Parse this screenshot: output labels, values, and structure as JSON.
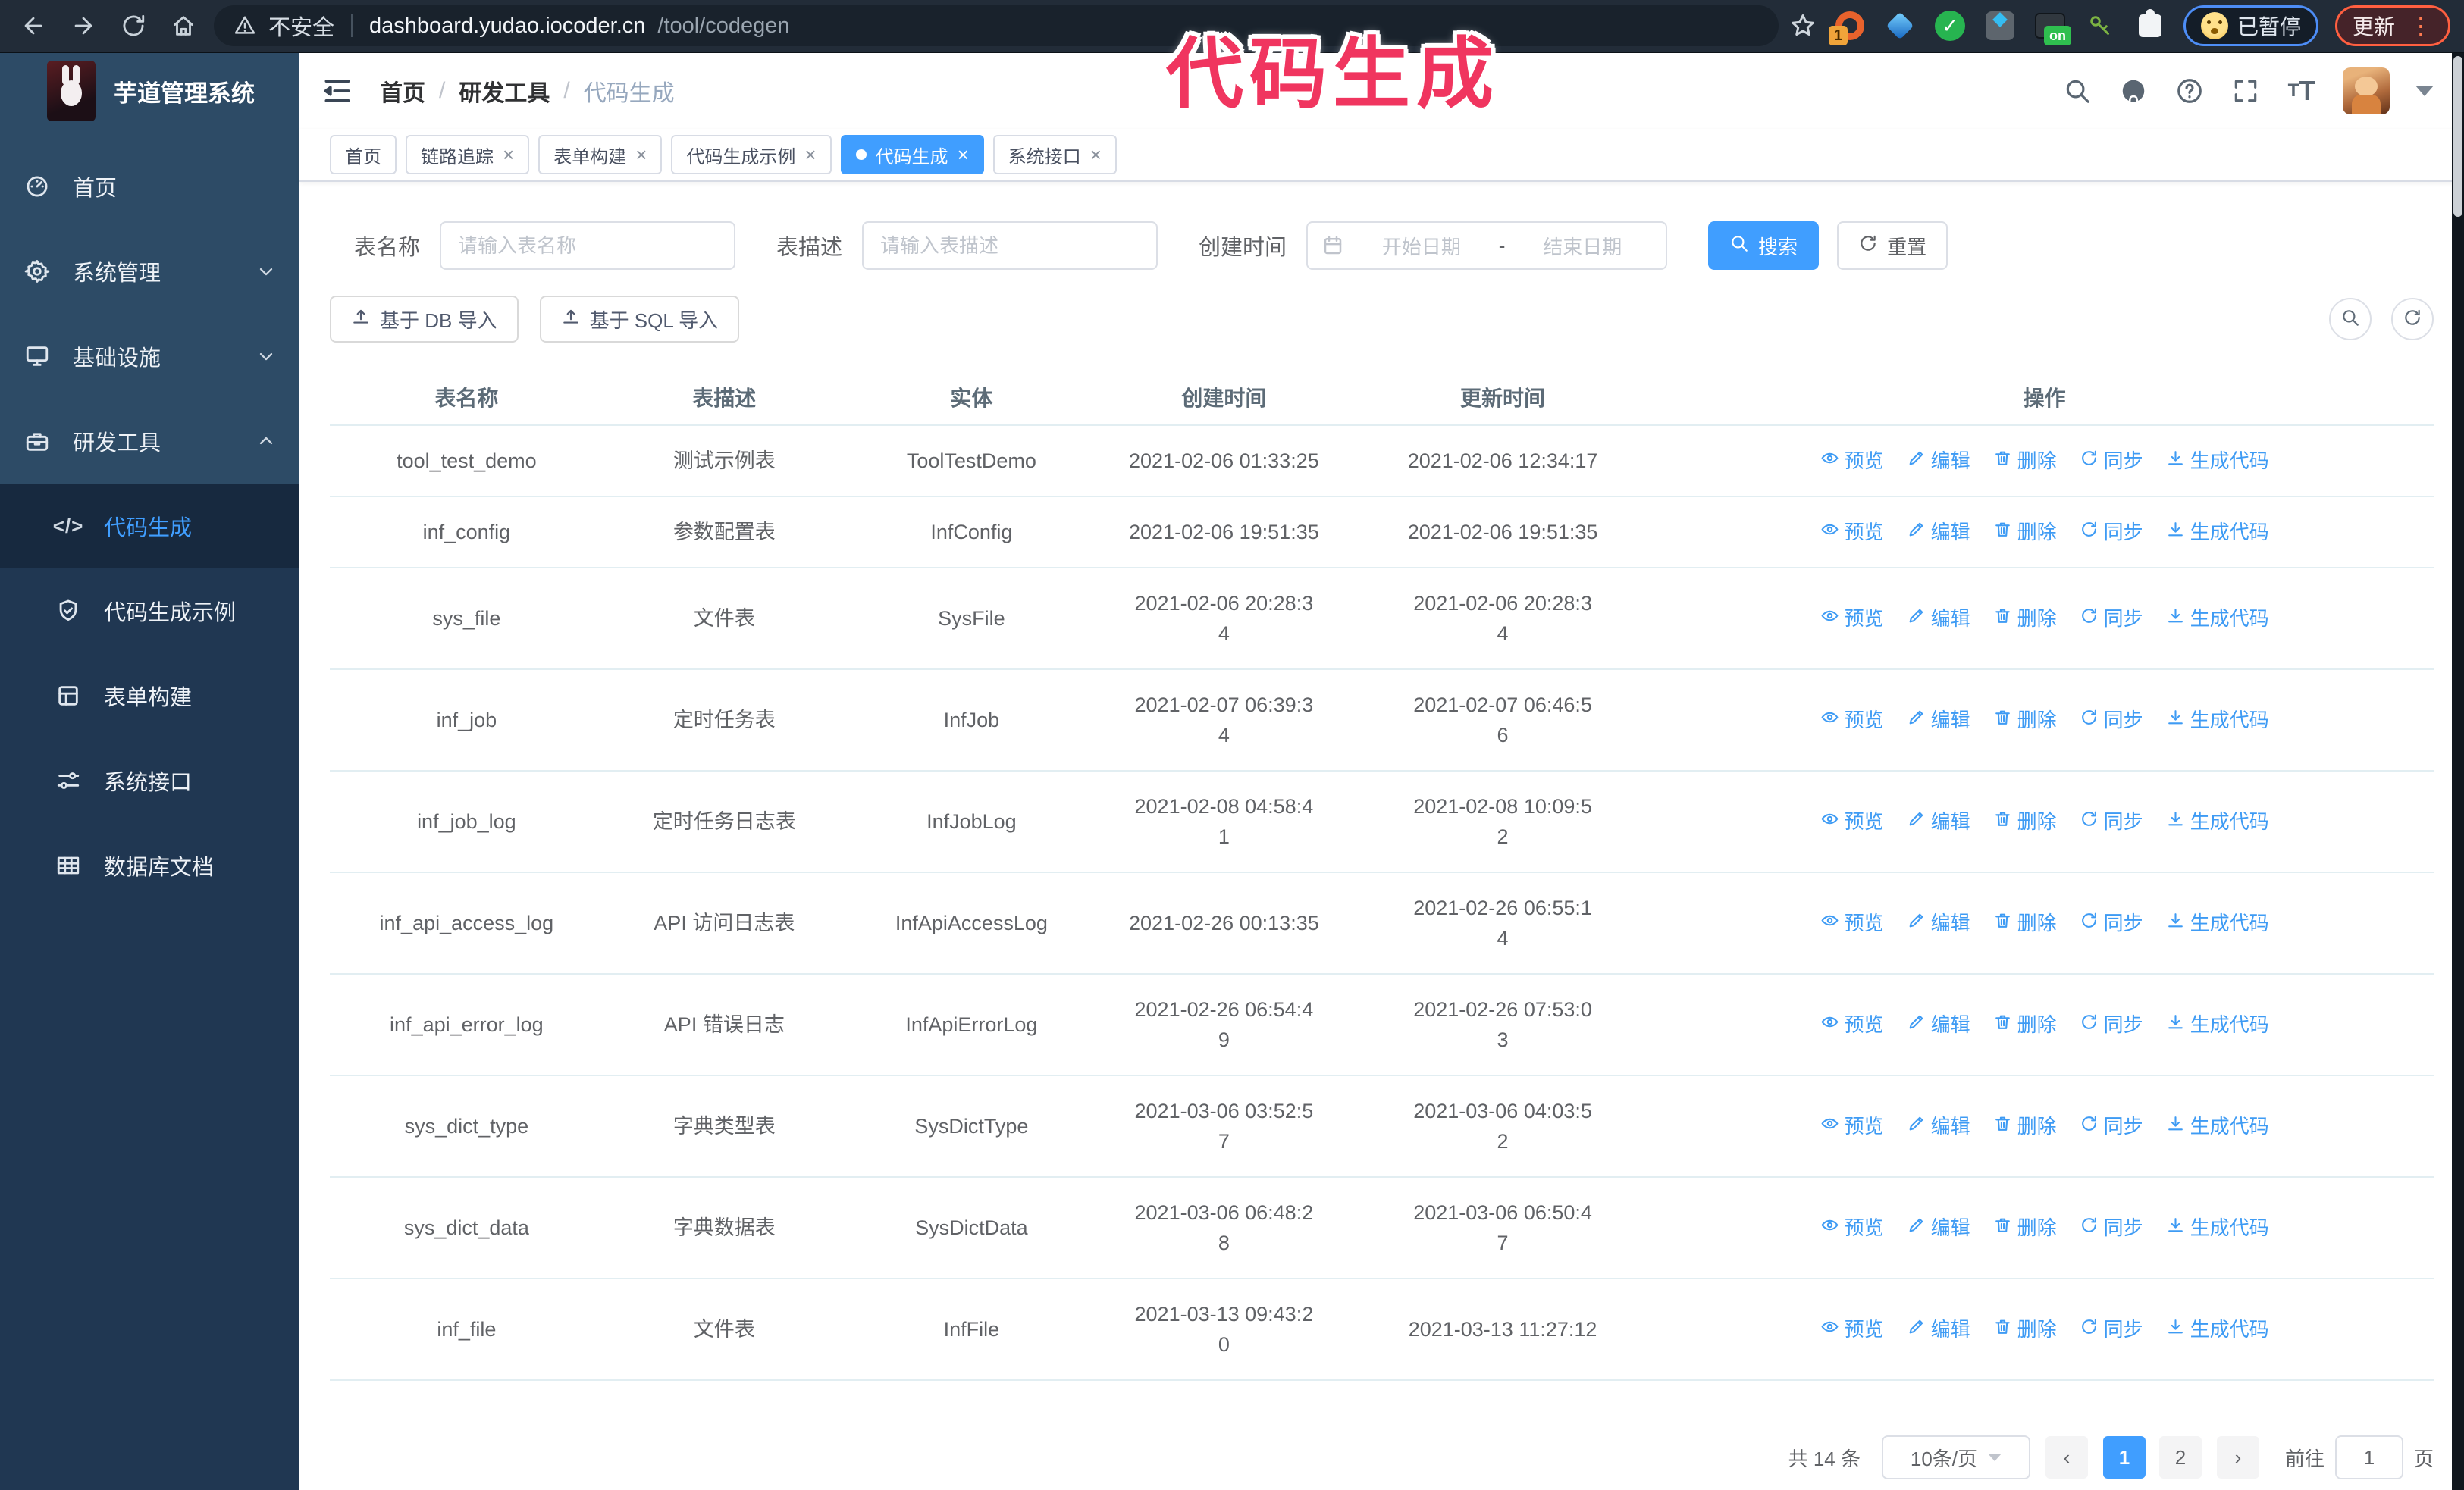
{
  "overlay": {
    "title": "代码生成",
    "color": "#f0355f"
  },
  "browser": {
    "security_label": "不安全",
    "url_host": "dashboard.yudao.iocoder.cn",
    "url_path": "/tool/codegen",
    "extension_badge_count": "1",
    "extension_badge_on": "on",
    "paused_badge": "已暂停",
    "update_button": "更新"
  },
  "sidebar": {
    "logo_title": "芋道管理系统",
    "items": [
      {
        "label": "首页",
        "icon": "dashboard-icon"
      },
      {
        "label": "系统管理",
        "icon": "gear-icon",
        "chevron": "down"
      },
      {
        "label": "基础设施",
        "icon": "monitor-icon",
        "chevron": "down"
      },
      {
        "label": "研发工具",
        "icon": "toolbox-icon",
        "chevron": "up",
        "expanded": true,
        "children": [
          {
            "label": "代码生成",
            "icon": "code-icon",
            "active": true
          },
          {
            "label": "代码生成示例",
            "icon": "badge-check-icon"
          },
          {
            "label": "表单构建",
            "icon": "form-icon"
          },
          {
            "label": "系统接口",
            "icon": "api-icon"
          },
          {
            "label": "数据库文档",
            "icon": "table-grid-icon"
          }
        ]
      }
    ]
  },
  "navbar": {
    "breadcrumb": [
      "首页",
      "研发工具",
      "代码生成"
    ],
    "separator": "/"
  },
  "tabs": [
    {
      "label": "首页",
      "closable": false,
      "active": false
    },
    {
      "label": "链路追踪",
      "closable": true,
      "active": false
    },
    {
      "label": "表单构建",
      "closable": true,
      "active": false
    },
    {
      "label": "代码生成示例",
      "closable": true,
      "active": false
    },
    {
      "label": "代码生成",
      "closable": true,
      "active": true
    },
    {
      "label": "系统接口",
      "closable": true,
      "active": false
    }
  ],
  "search_form": {
    "table_name_label": "表名称",
    "table_name_placeholder": "请输入表名称",
    "table_desc_label": "表描述",
    "table_desc_placeholder": "请输入表描述",
    "create_time_label": "创建时间",
    "start_placeholder": "开始日期",
    "range_separator": "-",
    "end_placeholder": "结束日期",
    "search_button": "搜索",
    "reset_button": "重置"
  },
  "toolbar": {
    "import_db_button": "基于 DB 导入",
    "import_sql_button": "基于 SQL 导入"
  },
  "table": {
    "columns": [
      "表名称",
      "表描述",
      "实体",
      "创建时间",
      "更新时间",
      "操作"
    ],
    "rows": [
      {
        "name": "tool_test_demo",
        "desc": "测试示例表",
        "entity": "ToolTestDemo",
        "created": "2021-02-06 01:33:25",
        "updated": "2021-02-06 12:34:17"
      },
      {
        "name": "inf_config",
        "desc": "参数配置表",
        "entity": "InfConfig",
        "created": "2021-02-06 19:51:35",
        "updated": "2021-02-06 19:51:35"
      },
      {
        "name": "sys_file",
        "desc": "文件表",
        "entity": "SysFile",
        "created": "2021-02-06 20:28:3\n4",
        "updated": "2021-02-06 20:28:3\n4"
      },
      {
        "name": "inf_job",
        "desc": "定时任务表",
        "entity": "InfJob",
        "created": "2021-02-07 06:39:3\n4",
        "updated": "2021-02-07 06:46:5\n6"
      },
      {
        "name": "inf_job_log",
        "desc": "定时任务日志表",
        "entity": "InfJobLog",
        "created": "2021-02-08 04:58:4\n1",
        "updated": "2021-02-08 10:09:5\n2"
      },
      {
        "name": "inf_api_access_log",
        "desc": "API 访问日志表",
        "entity": "InfApiAccessLog",
        "created": "2021-02-26 00:13:35",
        "updated": "2021-02-26 06:55:1\n4"
      },
      {
        "name": "inf_api_error_log",
        "desc": "API 错误日志",
        "entity": "InfApiErrorLog",
        "created": "2021-02-26 06:54:4\n9",
        "updated": "2021-02-26 07:53:0\n3"
      },
      {
        "name": "sys_dict_type",
        "desc": "字典类型表",
        "entity": "SysDictType",
        "created": "2021-03-06 03:52:5\n7",
        "updated": "2021-03-06 04:03:5\n2"
      },
      {
        "name": "sys_dict_data",
        "desc": "字典数据表",
        "entity": "SysDictData",
        "created": "2021-03-06 06:48:2\n8",
        "updated": "2021-03-06 06:50:4\n7"
      },
      {
        "name": "inf_file",
        "desc": "文件表",
        "entity": "InfFile",
        "created": "2021-03-13 09:43:2\n0",
        "updated": "2021-03-13 11:27:12"
      }
    ],
    "row_actions": [
      {
        "key": "preview",
        "label": "预览",
        "icon": "eye-icon"
      },
      {
        "key": "edit",
        "label": "编辑",
        "icon": "edit-icon"
      },
      {
        "key": "delete",
        "label": "删除",
        "icon": "trash-icon"
      },
      {
        "key": "sync",
        "label": "同步",
        "icon": "sync-icon"
      },
      {
        "key": "generate",
        "label": "生成代码",
        "icon": "download-icon"
      }
    ]
  },
  "pagination": {
    "total": "共 14 条",
    "page_size": "10条/页",
    "pages": [
      "1",
      "2"
    ],
    "active_page": "1",
    "goto_label": "前往",
    "goto_value": "1",
    "goto_unit": "页"
  },
  "colors": {
    "primary": "#409eff",
    "sidebar_bg": "#2d4b66",
    "submenu_bg": "#203752",
    "overlay_pink": "#f0355f"
  }
}
